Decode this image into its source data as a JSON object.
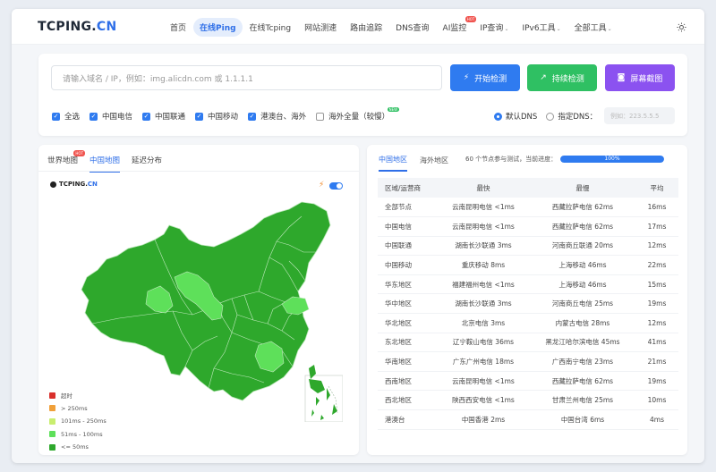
{
  "header": {
    "logo_main": "TCPING.",
    "logo_cn": "CN",
    "nav": [
      {
        "label": "首页"
      },
      {
        "label": "在线Ping"
      },
      {
        "label": "在线Tcping"
      },
      {
        "label": "网站测速"
      },
      {
        "label": "路由追踪"
      },
      {
        "label": "DNS查询"
      },
      {
        "label": "AI监控"
      },
      {
        "label": "IP查询"
      },
      {
        "label": "IPv6工具"
      },
      {
        "label": "全部工具"
      }
    ],
    "hot_badge": "HOT",
    "theme_icon": "sun-icon"
  },
  "search": {
    "placeholder": "请输入域名 / IP，例如：img.alicdn.com 或 1.1.1.1",
    "start_label": "开始检测",
    "continuous_label": "持续检测",
    "screenshot_label": "屏幕截图",
    "checks": [
      {
        "label": "全选"
      },
      {
        "label": "中国电信"
      },
      {
        "label": "中国联通"
      },
      {
        "label": "中国移动"
      },
      {
        "label": "港澳台、海外"
      },
      {
        "label": "海外全量（较慢）"
      }
    ],
    "new_badge": "NEW",
    "dns_default": "默认DNS",
    "dns_custom": "指定DNS：",
    "dns_placeholder": "例如：223.5.5.5"
  },
  "map": {
    "tabs": [
      {
        "label": "世界地图"
      },
      {
        "label": "中国地图"
      },
      {
        "label": "延迟分布"
      }
    ],
    "logo_main": "TCPING.",
    "logo_cn": "CN",
    "legend": [
      {
        "label": "超时",
        "color": "#d9302c"
      },
      {
        "label": "> 250ms",
        "color": "#f0a03a"
      },
      {
        "label": "101ms - 250ms",
        "color": "#c9ee6f"
      },
      {
        "label": "51ms - 100ms",
        "color": "#5ee05a"
      },
      {
        "label": "<= 50ms",
        "color": "#2ea82c"
      }
    ]
  },
  "results": {
    "tabs": [
      {
        "label": "中国地区"
      },
      {
        "label": "海外地区"
      }
    ],
    "progress_text": "60 个节点参与测试，当前进度：",
    "progress_label": "100%",
    "progress_value": 100,
    "columns": [
      "区域/运营商",
      "最快",
      "最慢",
      "平均"
    ],
    "rows": [
      [
        "全部节点",
        "云南昆明电信 <1ms",
        "西藏拉萨电信 62ms",
        "16ms"
      ],
      [
        "中国电信",
        "云南昆明电信 <1ms",
        "西藏拉萨电信 62ms",
        "17ms"
      ],
      [
        "中国联通",
        "湖南长沙联通 3ms",
        "河南商丘联通 20ms",
        "12ms"
      ],
      [
        "中国移动",
        "重庆移动 8ms",
        "上海移动 46ms",
        "22ms"
      ],
      [
        "华东地区",
        "福建福州电信 <1ms",
        "上海移动 46ms",
        "15ms"
      ],
      [
        "华中地区",
        "湖南长沙联通 3ms",
        "河南商丘电信 25ms",
        "19ms"
      ],
      [
        "华北地区",
        "北京电信 3ms",
        "内蒙古电信 28ms",
        "12ms"
      ],
      [
        "东北地区",
        "辽宁鞍山电信 36ms",
        "黑龙江哈尔滨电信 45ms",
        "41ms"
      ],
      [
        "华南地区",
        "广东广州电信 18ms",
        "广西南宁电信 23ms",
        "21ms"
      ],
      [
        "西南地区",
        "云南昆明电信 <1ms",
        "西藏拉萨电信 62ms",
        "19ms"
      ],
      [
        "西北地区",
        "陕西西安电信 <1ms",
        "甘肃兰州电信 25ms",
        "10ms"
      ],
      [
        "港澳台",
        "中国香港 2ms",
        "中国台湾 6ms",
        "4ms"
      ]
    ]
  },
  "colors": {
    "accent": "#2f7bf0",
    "green": "#2fc063",
    "purple": "#8b52f0",
    "map_dark": "#2ea82c",
    "map_light": "#5ee05a"
  }
}
